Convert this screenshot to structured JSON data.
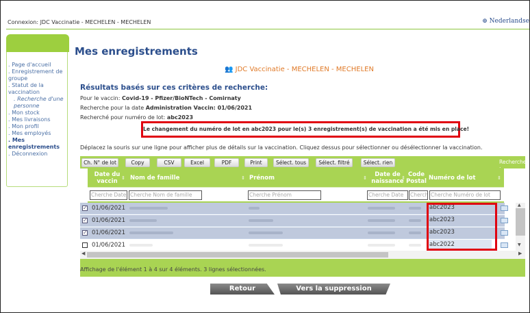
{
  "connection": "Connexion: JDC Vaccinatie - MECHELEN - MECHELEN",
  "language": "Nederlandse",
  "language_icon": "globe-icon",
  "nav": [
    "Page d'accueil",
    "Enregistrement de groupe",
    "Statut de la vaccination",
    "Recherche d'une personne",
    "Mon stock",
    "Mes livraisons",
    "Mon profil",
    "Mes employés",
    "Mes enregistrements",
    "Déconnexion"
  ],
  "page_title": "Mes enregistrements",
  "center_banner": "JDC Vaccinatie - MECHELEN - MECHELEN",
  "results_title": "Résultats basés sur ces critères de recherche:",
  "criteria": {
    "vaccine_label": "Pour le vaccin: ",
    "vaccine_value": "Covid-19 - Pfizer/BioNTech - Comirnaty",
    "date_label": "Recherche pour la date ",
    "date_value": "Administration Vaccin: 01/06/2021",
    "lot_label": "Recherché pour numéro de lot: ",
    "lot_value": "abc2023"
  },
  "alert": "Le changement du numéro de lot en abc2023 pour le(s) 3 enregistrement(s) de vaccination a été mis en place!",
  "hint": "Déplacez la souris sur une ligne pour afficher plus de détails sur la vaccination. Cliquez dessus pour sélectionner ou désélectionner la vaccination.",
  "toolbar": {
    "ch_lot": "Ch. N° de lot",
    "copy": "Copy",
    "csv": "CSV",
    "excel": "Excel",
    "pdf": "PDF",
    "print": "Print",
    "select_all": "Sélect. tous",
    "select_filtered": "Sélect. filtré",
    "select_none": "Sélect. rien",
    "search_label": "Rechercher :"
  },
  "columns": {
    "date": "Date du vaccin",
    "last_name": "Nom de famille",
    "first_name": "Prénom",
    "birth": "Date de naissance",
    "postal": "Code Postal",
    "lot": "Numéro de lot"
  },
  "filters": {
    "date": "Cherche Date",
    "last_name": "Cherche Nom de famille",
    "first_name": "Cherche Prénom",
    "birth": "Cherche Date",
    "postal": "Cherche",
    "lot": "Cherche Numéro de lot"
  },
  "rows": [
    {
      "date": "01/06/2021",
      "lot": "abc2023",
      "selected": true
    },
    {
      "date": "01/06/2021",
      "lot": "abc2023",
      "selected": true
    },
    {
      "date": "01/06/2021",
      "lot": "abc2023",
      "selected": true
    },
    {
      "date": "01/06/2021",
      "lot": "abc2022",
      "selected": false
    }
  ],
  "info": "Affichage de l'élément 1 à 4 sur 4 éléments.    3 lignes sélectionnées.",
  "buttons": {
    "back": "Retour",
    "delete": "Vers la suppression"
  },
  "colors": {
    "green": "#a9d453",
    "blue_heading": "#2b4e8c",
    "alert_border": "#e0000f",
    "selected_row": "#bfc9dd"
  }
}
